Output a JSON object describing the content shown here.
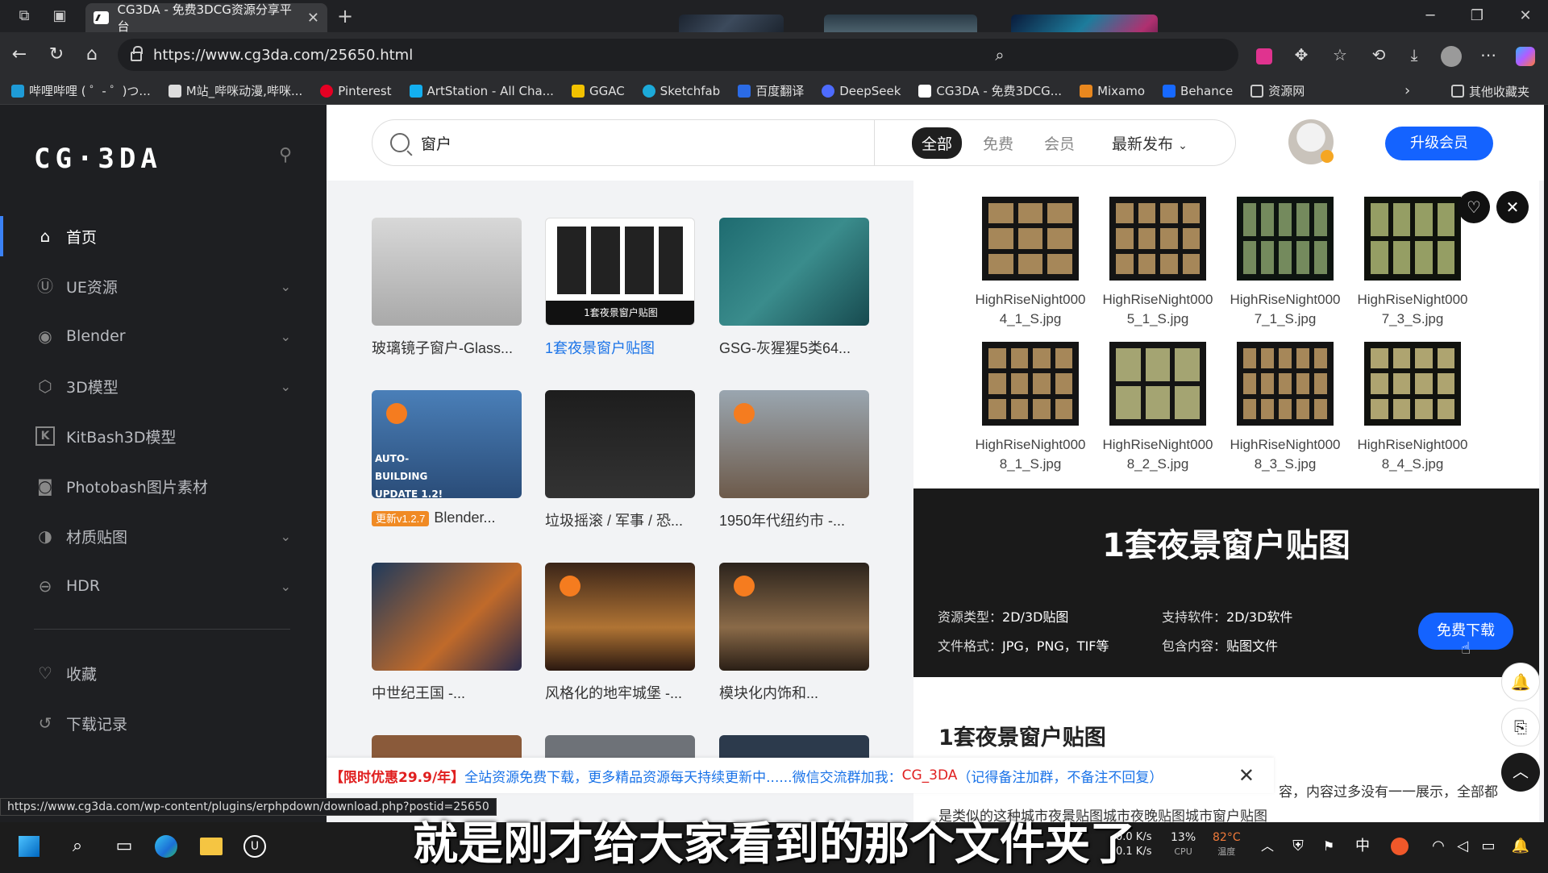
{
  "browser": {
    "tab_title": "CG3DA - 免费3DCG资源分享平台",
    "url": "https://www.cg3da.com/25650.html",
    "bookmarks": [
      "哔哩哔哩 ( ゜- ゜)つ...",
      "M站_哔咪动漫,哔咪...",
      "Pinterest",
      "ArtStation - All Cha...",
      "GGAC",
      "Sketchfab",
      "百度翻译",
      "DeepSeek",
      "CG3DA - 免费3DCG...",
      "Mixamo",
      "Behance",
      "资源网"
    ],
    "bookmark_folder": "其他收藏夹",
    "status_url": "https://www.cg3da.com/wp-content/plugins/erphpdown/download.php?postid=25650"
  },
  "sidebar": {
    "logo": "CG·3DA",
    "items": [
      {
        "label": "首页",
        "icon": "home-icon",
        "active": true
      },
      {
        "label": "UE资源",
        "icon": "unreal-icon",
        "expandable": true
      },
      {
        "label": "Blender",
        "icon": "blender-icon",
        "expandable": true
      },
      {
        "label": "3D模型",
        "icon": "cube-icon",
        "expandable": true
      },
      {
        "label": "KitBash3D模型",
        "icon": "kitbash-icon"
      },
      {
        "label": "Photobash图片素材",
        "icon": "camera-icon"
      },
      {
        "label": "材质贴图",
        "icon": "material-icon",
        "expandable": true
      },
      {
        "label": "HDR",
        "icon": "hdr-icon",
        "expandable": true
      }
    ],
    "bottom": [
      {
        "label": "收藏",
        "icon": "heart-icon"
      },
      {
        "label": "下载记录",
        "icon": "history-icon"
      }
    ]
  },
  "header": {
    "search_value": "窗户",
    "filters": [
      "全部",
      "免费",
      "会员",
      "最新发布"
    ],
    "upgrade_label": "升级会员"
  },
  "grid": [
    {
      "caption": "玻璃镜子窗户-Glass..."
    },
    {
      "caption": "1套夜景窗户贴图",
      "overlay": "1套夜景窗户贴图"
    },
    {
      "caption": "GSG-灰猩猩5类64..."
    },
    {
      "caption": "Blender...",
      "tag": "更新v1.2.7",
      "overlay": "AUTO-BUILDING UPDATE 1.2!"
    },
    {
      "caption": "垃圾摇滚 / 军事 / 恐..."
    },
    {
      "caption": "1950年代纽约市 -..."
    },
    {
      "caption": "中世纪王国 -..."
    },
    {
      "caption": "风格化的地牢城堡 -..."
    },
    {
      "caption": "模块化内饰和..."
    }
  ],
  "files": [
    "HighRiseNight0004_1_S.jpg",
    "HighRiseNight0005_1_S.jpg",
    "HighRiseNight0007_1_S.jpg",
    "HighRiseNight0007_3_S.jpg",
    "HighRiseNight0008_1_S.jpg",
    "HighRiseNight0008_2_S.jpg",
    "HighRiseNight0008_3_S.jpg",
    "HighRiseNight0008_4_S.jpg"
  ],
  "detail": {
    "title": "1套夜景窗户贴图",
    "resource_type_label": "资源类型：",
    "resource_type": "2D/3D贴图",
    "software_label": "支持软件：",
    "software": "2D/3D软件",
    "format_label": "文件格式：",
    "format": "JPG，PNG，TIF等",
    "content_label": "包含内容：",
    "content": "贴图文件",
    "download_label": "免费下载",
    "article_title": "1套夜景窗户贴图",
    "article_snippet": "容，内容过多没有一一展示，全部都",
    "article_line2": "是类似的这种城市夜景贴图城市夜晚贴图城市窗户贴图"
  },
  "notice": {
    "highlight": "【限时优惠29.9/年】",
    "text": "全站资源免费下载，更多精品资源每天持续更新中......微信交流群加我：",
    "wechat": "CG_3DA",
    "tail": "（记得备注加群，不备注不回复）"
  },
  "subtitle": "就是刚才给大家看到的那个文件夹了",
  "taskbar": {
    "net_up": "0.0 K/s",
    "net_down": "0.1 K/s",
    "cpu": "13%",
    "cpu_label": "CPU",
    "temp": "82°C",
    "temp_label": "温度",
    "ime": "中"
  }
}
